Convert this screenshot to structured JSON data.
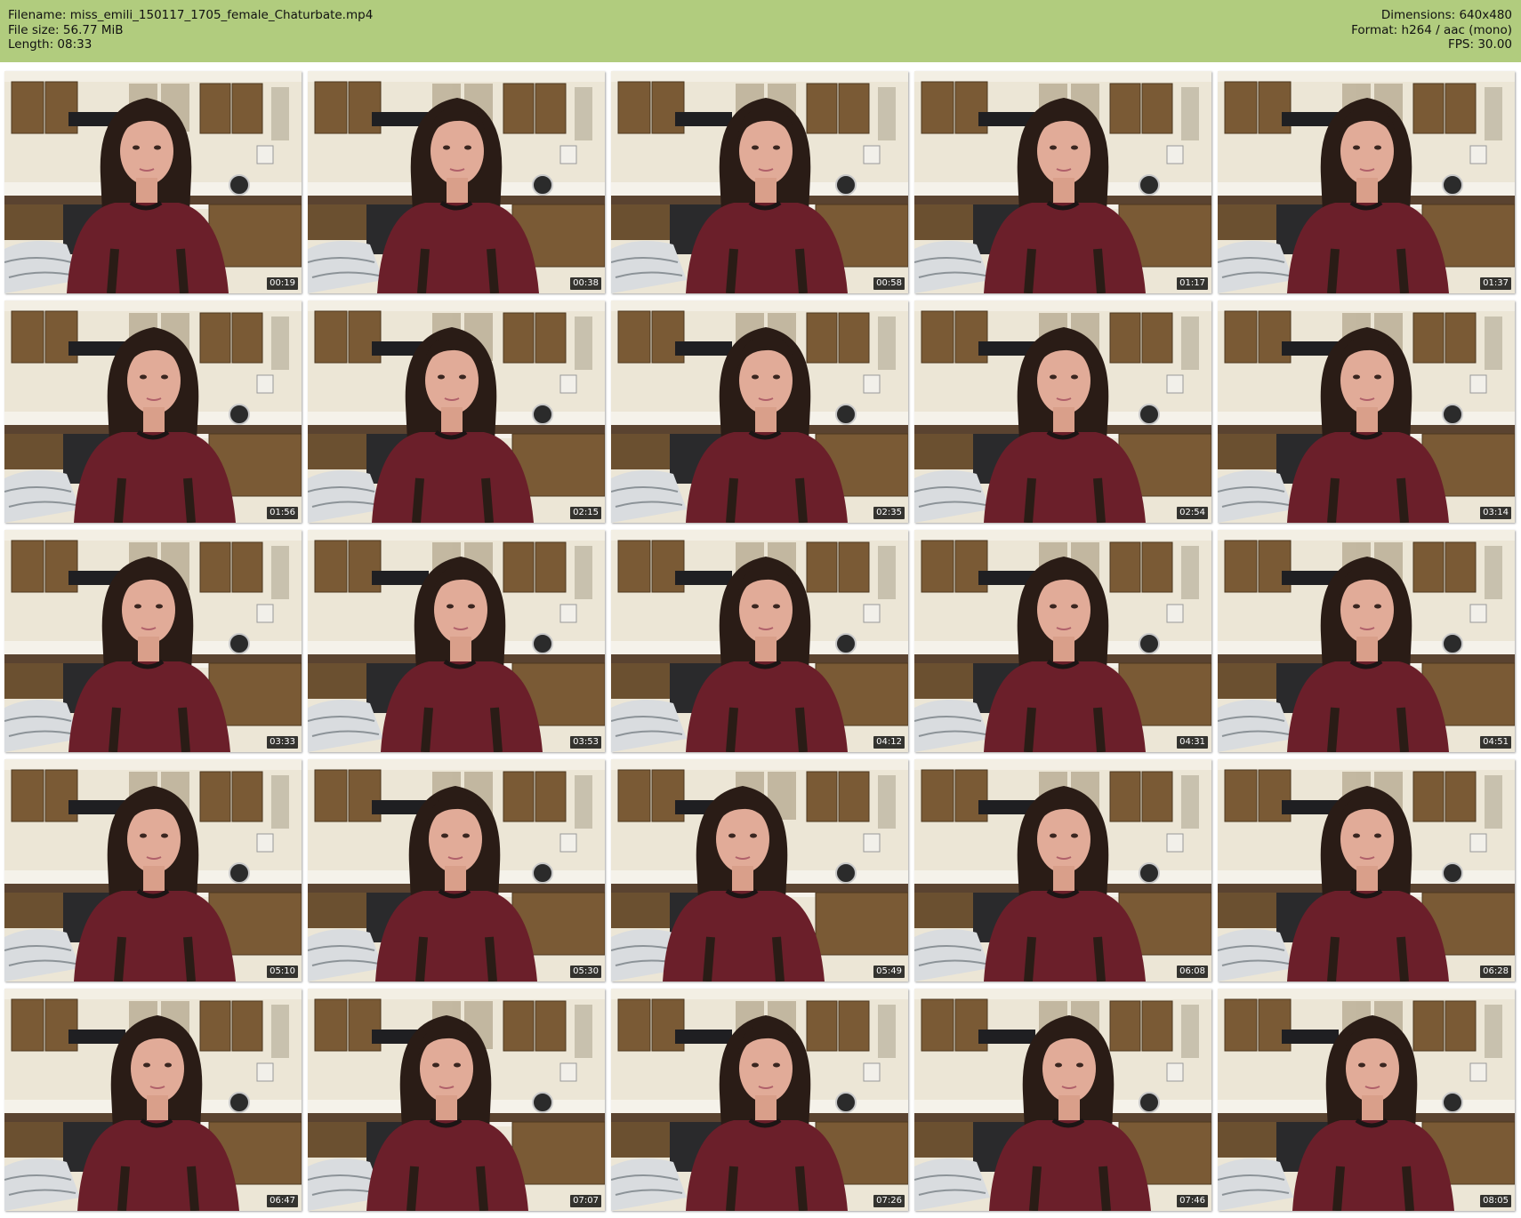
{
  "info": {
    "filename_label": "Filename:",
    "filename": "miss_emili_150117_1705_female_Chaturbate.mp4",
    "filesize_label": "File size:",
    "filesize": "56.77 MiB",
    "length_label": "Length:",
    "length": "08:33",
    "dimensions_label": "Dimensions:",
    "dimensions": "640x480",
    "format_label": "Format:",
    "format": "h264 / aac (mono)",
    "fps_label": "FPS:",
    "fps": "30.00"
  },
  "colors": {
    "header_bg": "#b1cc7e",
    "sweater": "#6b1f2a",
    "hair": "#2a1c16",
    "cabinet": "#7a5a35",
    "wall": "#e9e3d3"
  },
  "thumbnails": [
    {
      "timestamp": "00:19"
    },
    {
      "timestamp": "00:38"
    },
    {
      "timestamp": "00:58"
    },
    {
      "timestamp": "01:17"
    },
    {
      "timestamp": "01:37"
    },
    {
      "timestamp": "01:56"
    },
    {
      "timestamp": "02:15"
    },
    {
      "timestamp": "02:35"
    },
    {
      "timestamp": "02:54"
    },
    {
      "timestamp": "03:14"
    },
    {
      "timestamp": "03:33"
    },
    {
      "timestamp": "03:53"
    },
    {
      "timestamp": "04:12"
    },
    {
      "timestamp": "04:31"
    },
    {
      "timestamp": "04:51"
    },
    {
      "timestamp": "05:10"
    },
    {
      "timestamp": "05:30"
    },
    {
      "timestamp": "05:49"
    },
    {
      "timestamp": "06:08"
    },
    {
      "timestamp": "06:28"
    },
    {
      "timestamp": "06:47"
    },
    {
      "timestamp": "07:07"
    },
    {
      "timestamp": "07:26"
    },
    {
      "timestamp": "07:46"
    },
    {
      "timestamp": "08:05"
    }
  ]
}
